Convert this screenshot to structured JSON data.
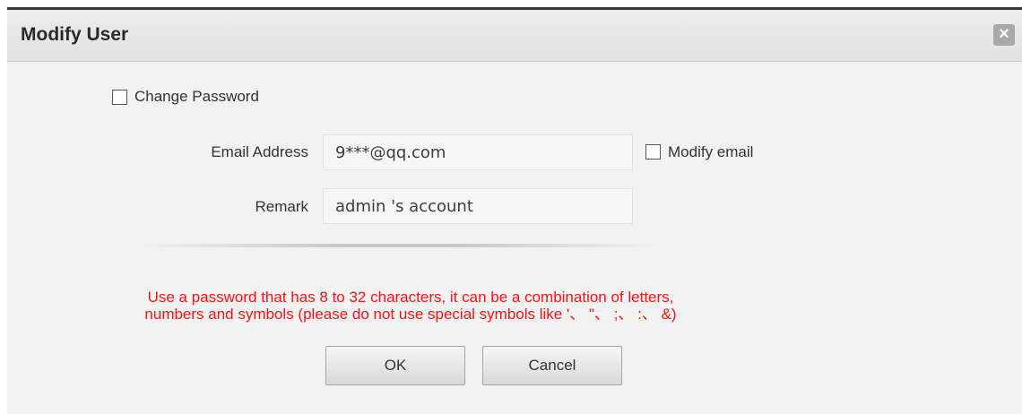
{
  "dialog": {
    "title": "Modify User",
    "close_icon": "close-icon"
  },
  "form": {
    "change_password_label": "Change Password",
    "change_password_checked": false,
    "email_label": "Email Address",
    "email_value": "9***@qq.com",
    "modify_email_label": "Modify email",
    "modify_email_checked": false,
    "remark_label": "Remark",
    "remark_value": "admin 's account"
  },
  "warning": {
    "line1": "Use a password that has 8 to 32 characters, it can be a combination of letters,",
    "line2": "numbers and symbols (please do not use special symbols like '、 \"、 ;、 :、 &)",
    "color": "#ff1111"
  },
  "buttons": {
    "ok_label": "OK",
    "cancel_label": "Cancel"
  }
}
